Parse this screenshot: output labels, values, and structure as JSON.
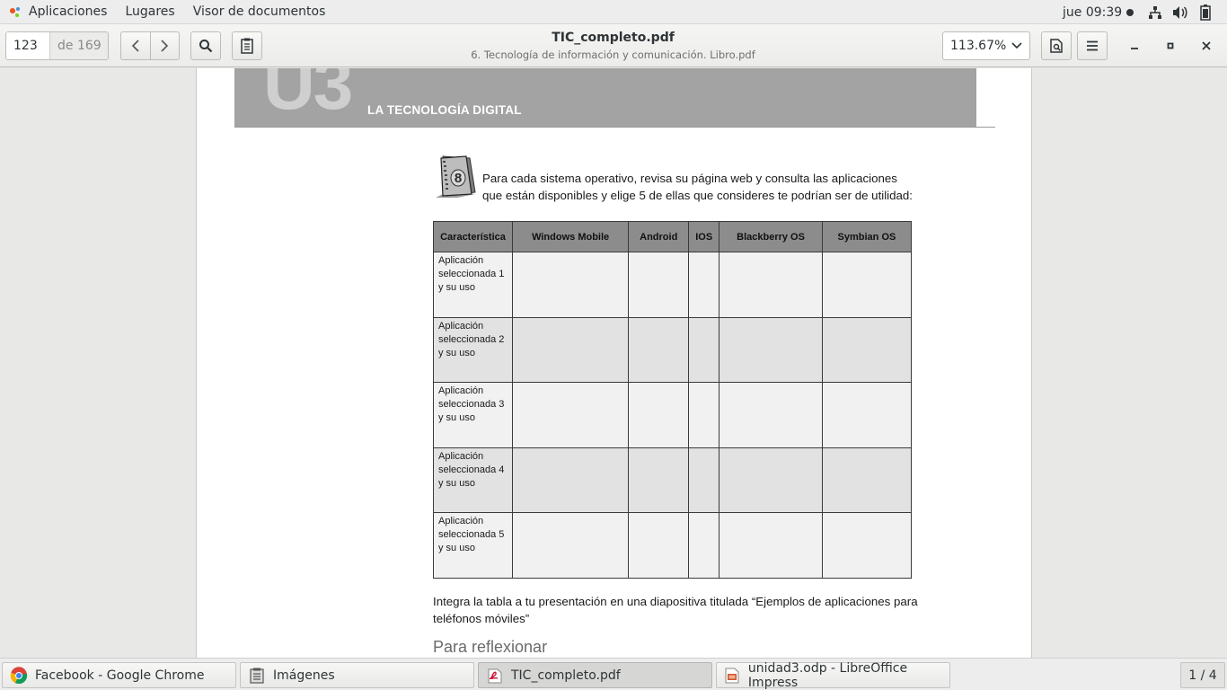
{
  "top_panel": {
    "menus": [
      "Aplicaciones",
      "Lugares",
      "Visor de documentos"
    ],
    "clock": "jue 09:39"
  },
  "toolbar": {
    "page_current": "123",
    "page_total": "de 169",
    "doc_title": "TIC_completo.pdf",
    "doc_subtitle": "6. Tecnología de información y comunicación. Libro.pdf",
    "zoom": "113.67%"
  },
  "document": {
    "unit_number": "U3",
    "unit_title": "LA TECNOLOGÍA DIGITAL",
    "activity_number": "8",
    "activity_text": "Para cada sistema operativo, revisa su página web y consulta las aplicaciones que están disponibles y elige 5 de ellas que consideres te podrían ser de utilidad:",
    "table": {
      "headers": [
        "Característica",
        "Windows Mobile",
        "Android",
        "IOS",
        "Blackberry OS",
        "Symbian OS"
      ],
      "rows": [
        "Aplicación seleccionada 1 y su uso",
        "Aplicación seleccionada 2 y su uso",
        "Aplicación seleccionada 3 y su uso",
        "Aplicación seleccionada 4 y su uso",
        "Aplicación seleccionada 5 y su uso"
      ]
    },
    "integrate_text": "Integra la tabla a tu presentación en una diapositiva titulada “Ejemplos de aplicaciones para teléfonos móviles”",
    "section_heading": "Para reflexionar"
  },
  "taskbar": {
    "tasks": [
      {
        "label": "Facebook - Google Chrome",
        "icon": "chrome-icon"
      },
      {
        "label": "Imágenes",
        "icon": "image-viewer-icon"
      },
      {
        "label": "TIC_completo.pdf",
        "icon": "pdf-viewer-icon"
      },
      {
        "label": "unidad3.odp - LibreOffice Impress",
        "icon": "impress-icon"
      }
    ],
    "workspace": "1 / 4"
  },
  "colors": {
    "banner": "#a3a3a3",
    "table_header": "#8c8c8c",
    "row_light": "#f1f1f1",
    "row_dark": "#e2e2e2"
  }
}
